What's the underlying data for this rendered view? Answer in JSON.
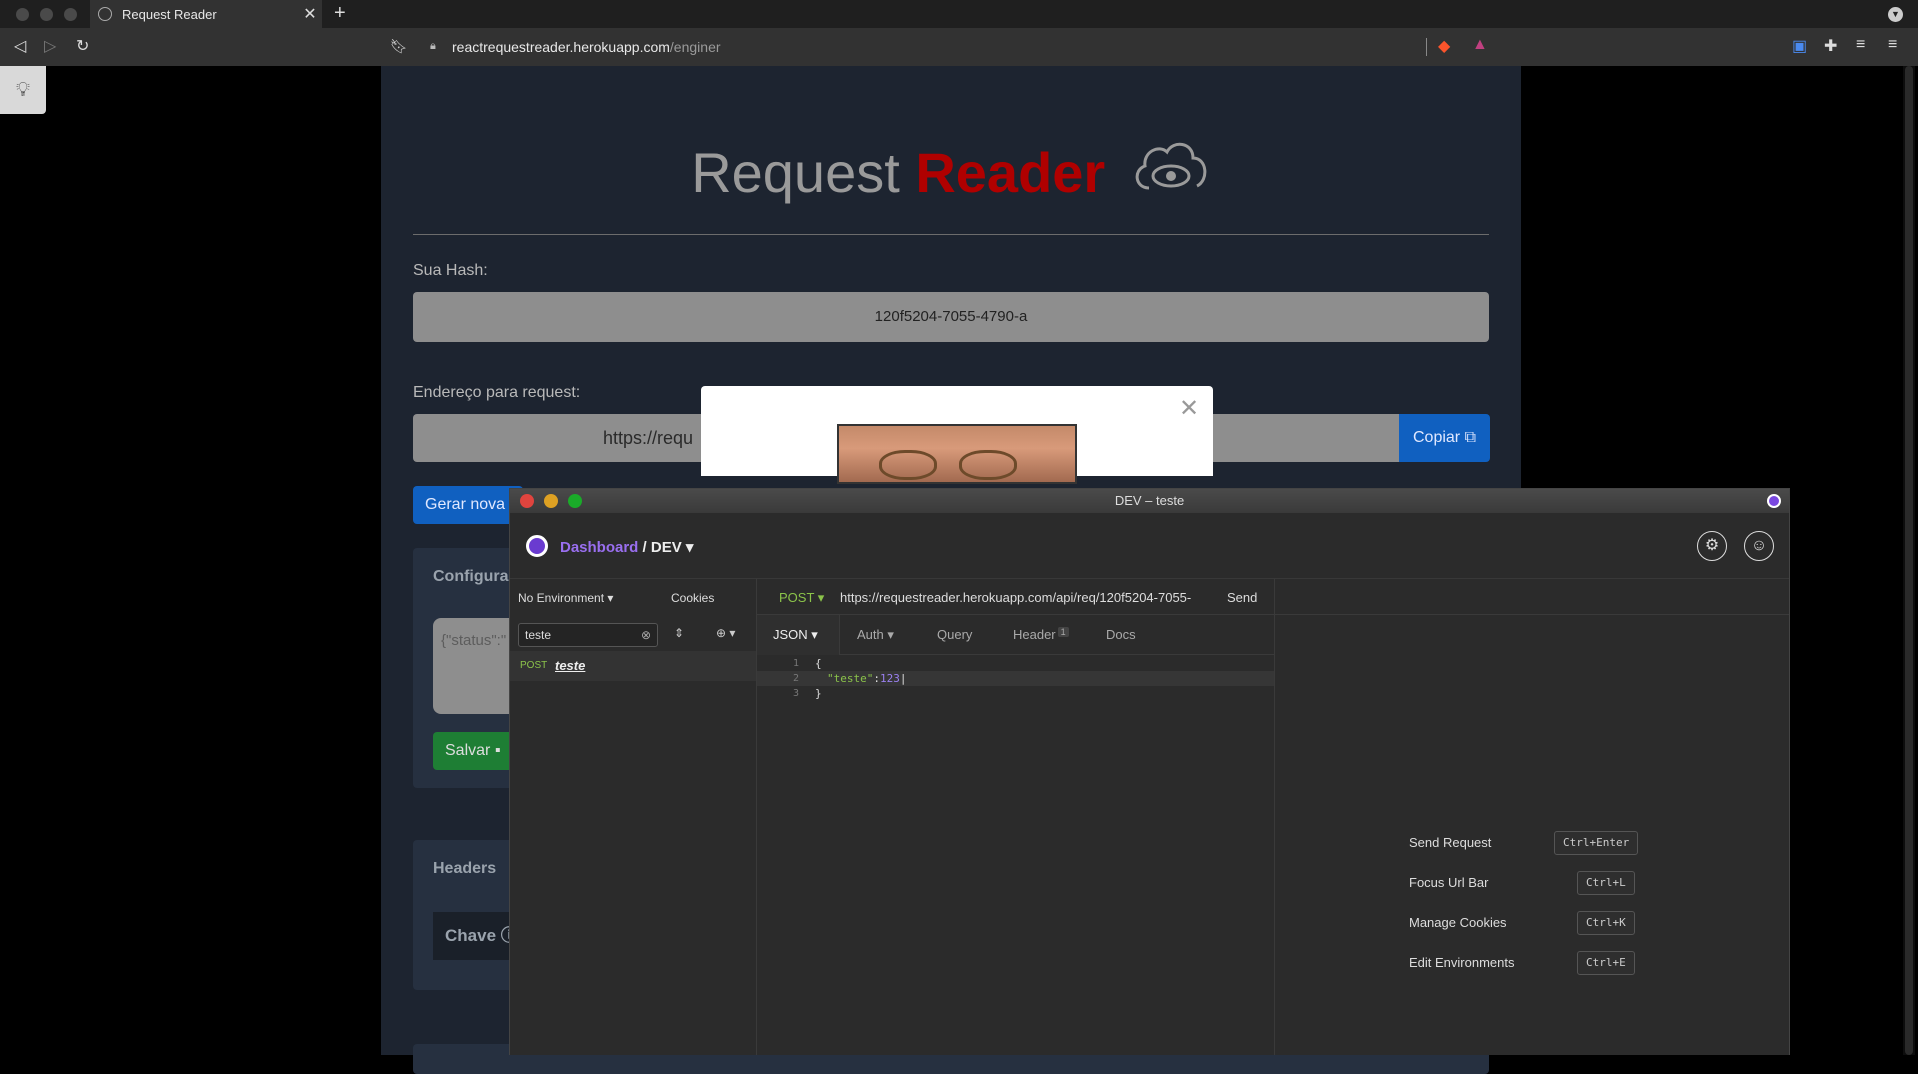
{
  "browser": {
    "tab_title": "Request Reader",
    "url_host": "reactrequestreader.herokuapp.com",
    "url_path": "/enginer"
  },
  "page": {
    "title_part1": "Request",
    "title_part2": "Reader",
    "hash_label": "Sua Hash:",
    "hash_value": "120f5204-7055-4790-a",
    "endpoint_label": "Endereço para request:",
    "endpoint_value": "https://requ",
    "copy_button": "Copiar",
    "generate_button": "Gerar nova",
    "config_heading": "Configura",
    "config_value": "{\"status\":\"",
    "save_button": "Salvar",
    "headers_heading": "Headers",
    "key_label": "Chave"
  },
  "insomnia": {
    "window_title": "DEV – teste",
    "breadcrumb_dashboard": "Dashboard",
    "breadcrumb_sep": " / ",
    "breadcrumb_workspace": "DEV",
    "environment": "No Environment",
    "cookies": "Cookies",
    "filter_value": "teste",
    "request_item": {
      "method": "POST",
      "name": "teste"
    },
    "method": "POST",
    "url": "https://requestreader.herokuapp.com/api/req/120f5204-7055-",
    "send": "Send",
    "tabs": {
      "json": "JSON",
      "auth": "Auth",
      "query": "Query",
      "header": "Header",
      "header_count": "1",
      "docs": "Docs"
    },
    "body_lines": [
      {
        "n": "1",
        "text": "{"
      },
      {
        "n": "2",
        "key": "\"teste\"",
        "sep": ":",
        "val": "123"
      },
      {
        "n": "3",
        "text": "}"
      }
    ],
    "shortcuts": [
      {
        "label": "Send Request",
        "key": "Ctrl+Enter"
      },
      {
        "label": "Focus Url Bar",
        "key": "Ctrl+L"
      },
      {
        "label": "Manage Cookies",
        "key": "Ctrl+K"
      },
      {
        "label": "Edit Environments",
        "key": "Ctrl+E"
      }
    ]
  },
  "colors": {
    "accent_purple": "#6a3bd0",
    "post_green": "#8bc34a",
    "brand_red": "#b00000",
    "button_blue": "#1060c0"
  }
}
